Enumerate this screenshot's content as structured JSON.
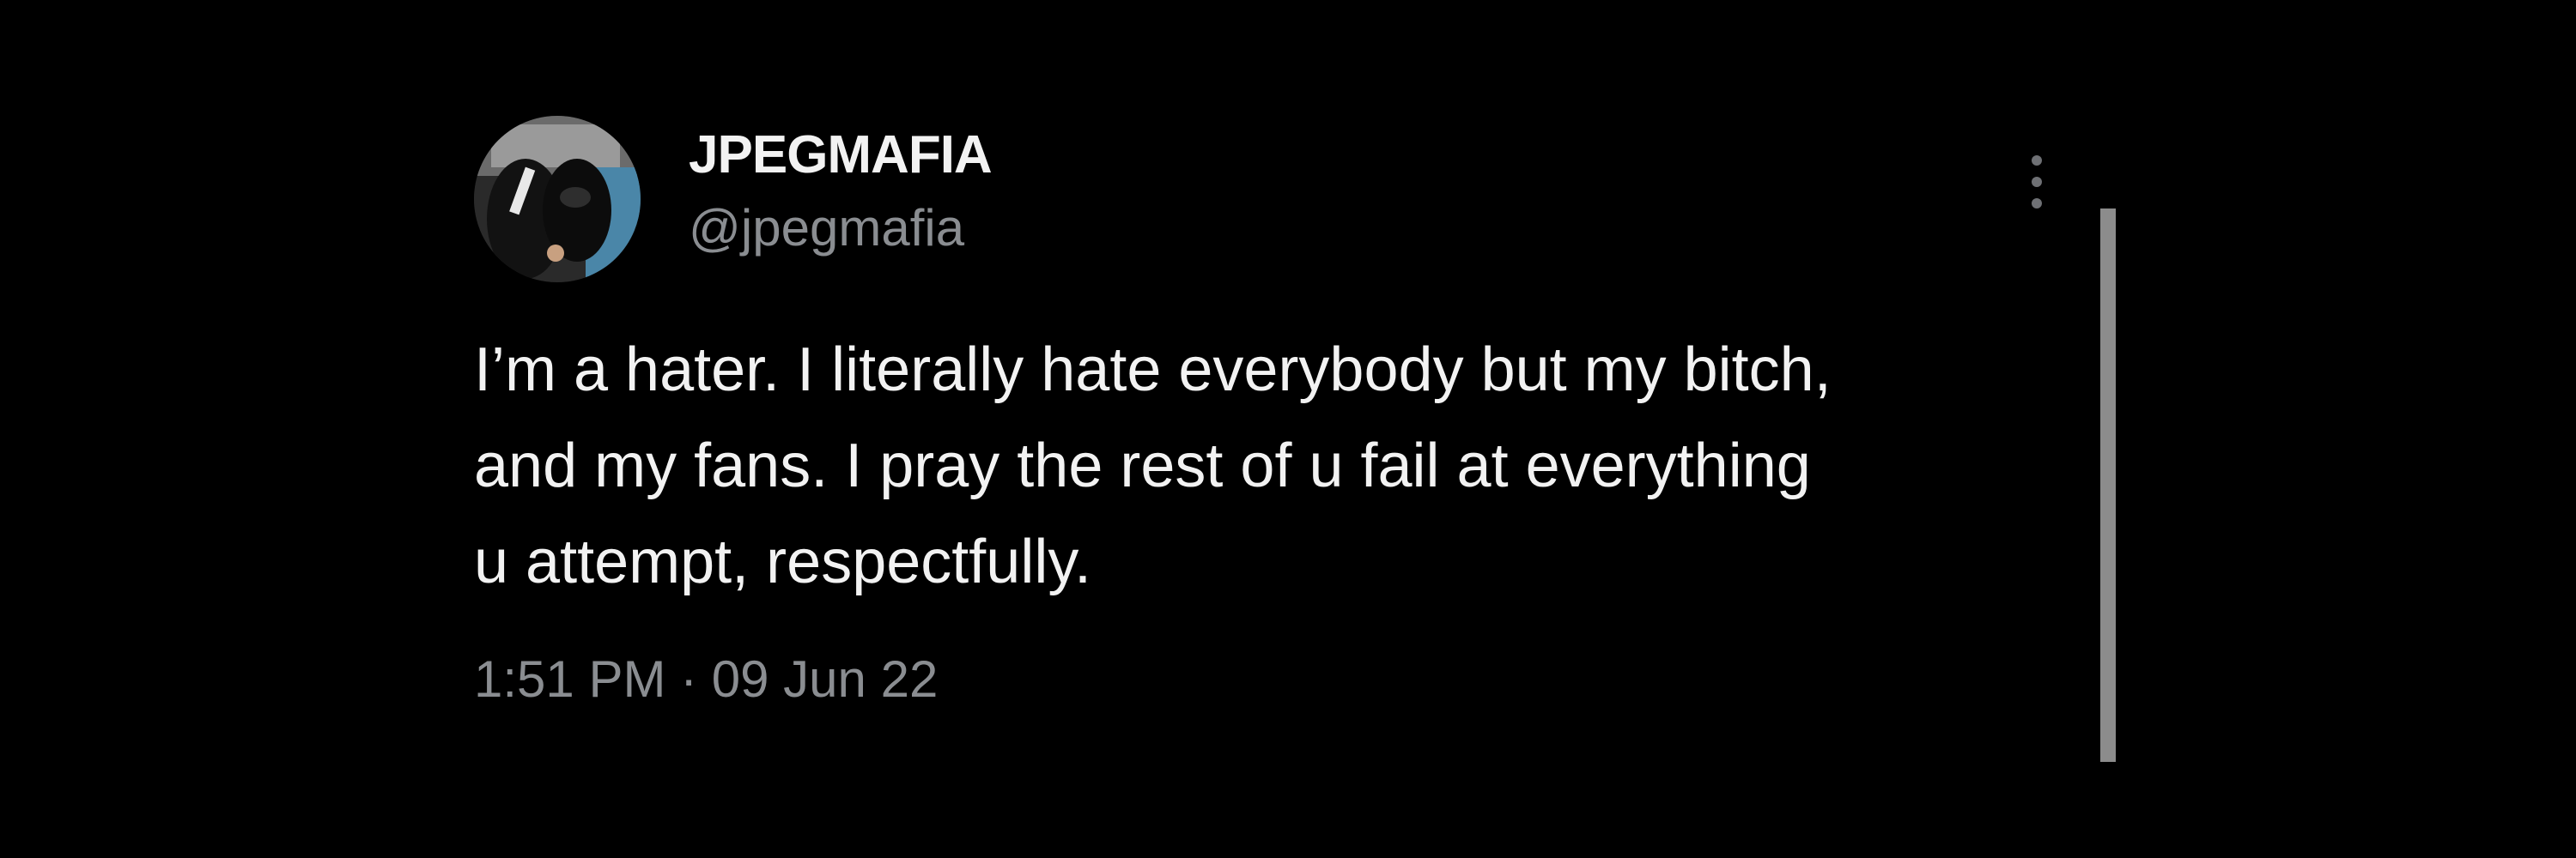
{
  "tweet": {
    "display_name": "JPEGMAFIA",
    "handle": "@jpegmafia",
    "text": "I’m a hater. I literally hate everybody but my bitch,\nand my fans. I pray the rest of u fail at everything\nu attempt, respectfully.",
    "timestamp": "1:51 PM · 09 Jun 22",
    "avatar_icon": "profile-photo",
    "more_icon": "more-vertical-icon"
  },
  "colors": {
    "background": "#000000",
    "primary_text": "#f2f2f2",
    "secondary_text": "#8a8d91",
    "scrollbar": "#8c8c8c"
  }
}
